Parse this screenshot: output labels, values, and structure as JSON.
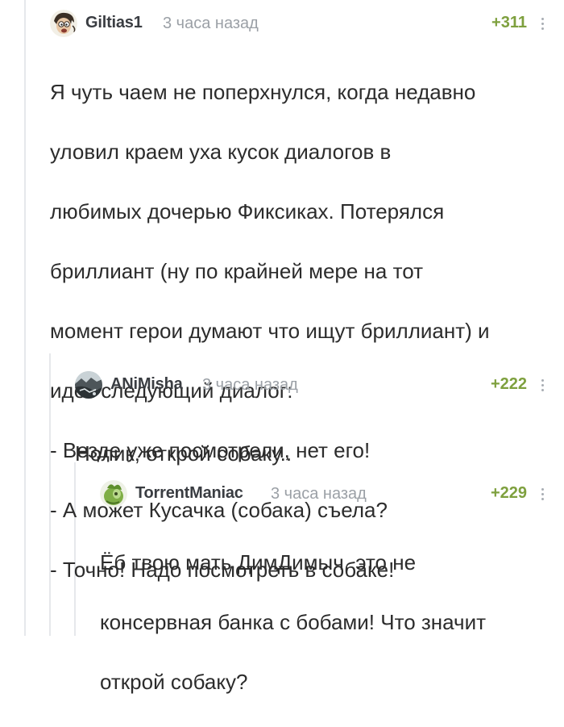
{
  "comments": [
    {
      "author": "Giltias1",
      "time": "3 часа назад",
      "rating": "+311",
      "avatar_icon": "cartoon-face-icon",
      "lines": [
        "Я чуть чаем не поперхнулся, когда недавно",
        "уловил краем уха кусок диалогов в",
        "любимых дочерью Фиксиках. Потерялся",
        "бриллиант (ну по крайней мере на тот",
        "момент герои думают что ищут бриллиант) и",
        "идёт следующий диалог:",
        "- Везде уже посмотрели, нет его!",
        "- А может Кусачка (собака) съела?",
        "- Точно! Надо посмотреть в собаке!"
      ]
    },
    {
      "author": "ANiMisha",
      "time": "3 часа назад",
      "rating": "+222",
      "avatar_icon": "landscape-photo-icon",
      "lines": [
        "Нолик, открой собаку.."
      ]
    },
    {
      "author": "TorrentManiac",
      "time": "3 часа назад",
      "rating": "+229",
      "avatar_icon": "green-creature-icon",
      "lines": [
        "Ёб твою мать ДимДимыч, это не",
        "консервная банка с бобами! Что значит",
        "открой собаку?"
      ]
    }
  ],
  "colors": {
    "rating": "#7ea03e",
    "time": "#9ba0a6",
    "author": "#3a3d42",
    "thread_line": "#e6e8eb"
  }
}
